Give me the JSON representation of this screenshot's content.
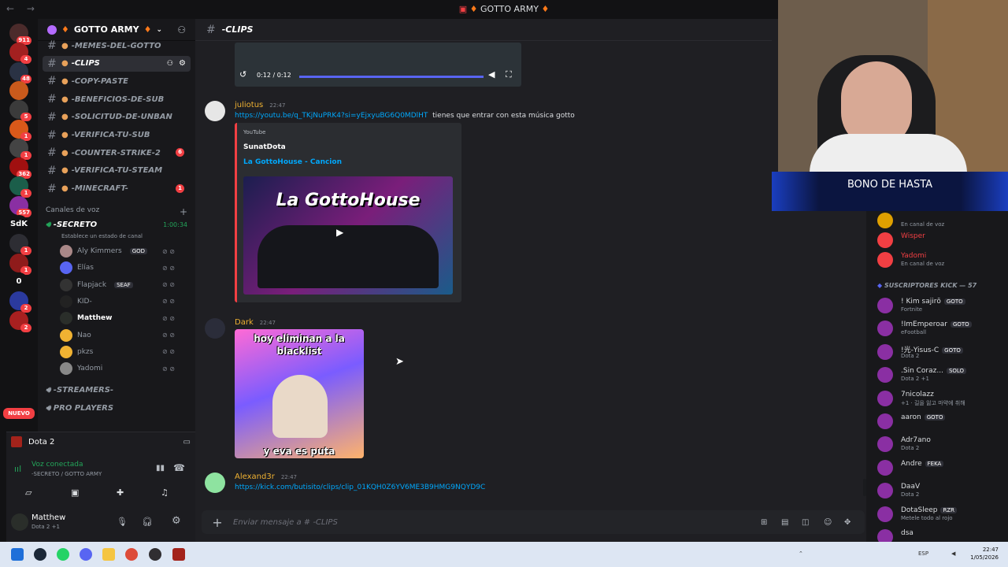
{
  "title_bar": {
    "title": "GOTTO ARMY",
    "nav": "← →"
  },
  "rail": {
    "servers": [
      {
        "label": "911",
        "color": "#4b2b2b"
      },
      {
        "label": "4",
        "color": "#a32020"
      },
      {
        "label": "48",
        "color": "#2a3244"
      },
      {
        "label": "",
        "color": "#c95a1c"
      },
      {
        "label": "5",
        "color": "#3b3b3b"
      },
      {
        "label": "1",
        "color": "#d9591a"
      },
      {
        "label": "1",
        "color": "#444"
      },
      {
        "label": "362",
        "color": "#a01010"
      },
      {
        "label": "1",
        "color": "#1b5e4a"
      },
      {
        "label": "557",
        "color": "#8a2fa3"
      },
      {
        "label": "SdK",
        "color": "#121214"
      },
      {
        "label": "1",
        "color": "#2d2d33"
      },
      {
        "label": "1",
        "color": "#8f1b1b"
      },
      {
        "label": "0",
        "color": "#121214"
      },
      {
        "label": "2",
        "color": "#2b3a9e"
      },
      {
        "label": "2",
        "color": "#a82020"
      }
    ],
    "nuevo": "NUEVO"
  },
  "guild": {
    "name": "GOTTO ARMY"
  },
  "channels": [
    {
      "name": "-MEMES-DEL-GOTTO",
      "badge": ""
    },
    {
      "name": "-CLIPS",
      "badge": ""
    },
    {
      "name": "-COPY-PASTE",
      "badge": ""
    },
    {
      "name": "-BENEFICIOS-DE-SUB",
      "badge": ""
    },
    {
      "name": "-SOLICITUD-DE-UNBAN",
      "badge": ""
    },
    {
      "name": "-VERIFICA-TU-SUB",
      "badge": ""
    },
    {
      "name": "-COUNTER-STRIKE-2",
      "badge": "6"
    },
    {
      "name": "-VERIFICA-TU-STEAM",
      "badge": ""
    },
    {
      "name": "-MINECRAFT-",
      "badge": "1"
    }
  ],
  "voice": {
    "header": "Canales de voz",
    "channel": "-SECRETO",
    "timer": "1:00:34",
    "status": "Establece un estado de canal",
    "users": [
      {
        "name": "Aly Kimmers",
        "tag": "GOD"
      },
      {
        "name": "Elías",
        "tag": ""
      },
      {
        "name": "Flapjack",
        "tag": "SEAF"
      },
      {
        "name": "KID-",
        "tag": ""
      },
      {
        "name": "Matthew",
        "tag": ""
      },
      {
        "name": "Nao",
        "tag": ""
      },
      {
        "name": "pkzs",
        "tag": ""
      },
      {
        "name": "Yadomi",
        "tag": ""
      }
    ],
    "other": [
      "-STREAMERS-",
      "PRO PLAYERS"
    ]
  },
  "activity": {
    "game": "Dota 2",
    "status": "Voz conectada",
    "location": "-SECRETO / GOTTO ARMY"
  },
  "user": {
    "name": "Matthew",
    "status": "Dota 2 +1"
  },
  "chat": {
    "channel": "-CLIPS",
    "clip_time": "0:12 / 0:12",
    "messages": [
      {
        "author": "juliotus",
        "time": "22:47",
        "link": "https://youtu.be/q_TKjNuPRK4?si=yEjxyuBG6Q0MDlHT",
        "text": "tienes que entrar con esta música gotto",
        "embed_provider": "YouTube",
        "embed_author": "SunatDota",
        "embed_title": "La GottoHouse - Cancion",
        "embed_image_text": "La GottoHouse"
      },
      {
        "author": "Dark",
        "time": "22:47",
        "gif_top": "hoy eliminan a la blacklist",
        "gif_bottom": "y eva es puta"
      },
      {
        "author": "Alexand3r",
        "time": "22:47",
        "link": "https://kick.com/butisito/clips/clip_01KQH0Z6YV6ME3B9HMG9NQYD9C"
      }
    ],
    "placeholder": "Enviar mensaje a # -CLIPS"
  },
  "overlay": {
    "bono": "BONO DE HASTA"
  },
  "members": {
    "top": [
      {
        "name": "",
        "status": "En canal de voz",
        "color": "#e0a000"
      },
      {
        "name": "Wisper",
        "status": "",
        "color": "#f23f43"
      },
      {
        "name": "Yadomi",
        "status": "En canal de voz",
        "color": "#f23f43"
      }
    ],
    "section": "SUSCRIPTORES KICK — 57",
    "list": [
      {
        "name": "! Kim sajirō",
        "tag": "GOTO",
        "status": "Fortnite"
      },
      {
        "name": "!ImEmperoar",
        "tag": "GOTO",
        "status": "eFootball"
      },
      {
        "name": "!光-Yisus-C",
        "tag": "GOTO",
        "status": "Dota 2"
      },
      {
        "name": ".Sin Coraz...",
        "tag": "SOLO",
        "status": "Dota 2 +1"
      },
      {
        "name": "7nicolazz",
        "tag": "",
        "status": "+1 · 길을 잃고 마약에 취해"
      },
      {
        "name": "aaron",
        "tag": "GOTO",
        "status": ""
      },
      {
        "name": "Adr7ano",
        "tag": "",
        "status": "Dota 2"
      },
      {
        "name": "Andre",
        "tag": "FEKA",
        "status": ""
      },
      {
        "name": "DaaV",
        "tag": "",
        "status": "Dota 2"
      },
      {
        "name": "DotaSleep",
        "tag": "RZR",
        "status": "Metele todo al rojo"
      },
      {
        "name": "dsa",
        "tag": "",
        "status": ""
      }
    ]
  },
  "taskbar": {
    "lang": "ESP",
    "time": "22:47",
    "date": "1/05/2026"
  }
}
